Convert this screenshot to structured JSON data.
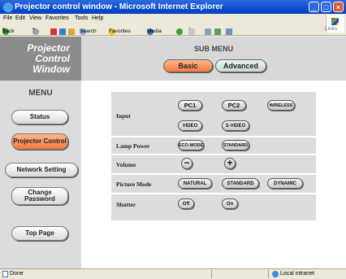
{
  "window": {
    "title": "Projector control window - Microsoft Internet Explorer"
  },
  "menubar": {
    "items": [
      "File",
      "Edit",
      "View",
      "Favorites",
      "Tools",
      "Help"
    ]
  },
  "toolbar": {
    "back": "Back",
    "search": "Search",
    "favorites": "Favorites",
    "media": "Media",
    "links": "Links"
  },
  "logo": {
    "line1": "Projector",
    "line2": "Control",
    "line3": "Window"
  },
  "sidebar": {
    "menu_title": "MENU",
    "items": [
      "Status",
      "Projector Control",
      "Network Setting",
      "Change Password",
      "Top Page"
    ],
    "active": "Projector Control"
  },
  "submenu": {
    "title": "SUB MENU",
    "basic": "Basic",
    "advanced": "Advanced",
    "active": "Basic"
  },
  "controls": {
    "input": {
      "label": "Input",
      "options": [
        "PC1",
        "PC2",
        "WIRELESS",
        "VIDEO",
        "S-VIDEO"
      ]
    },
    "lamp_power": {
      "label": "Lamp Power",
      "options": [
        "ECO-MODE",
        "STANDARD"
      ]
    },
    "volume": {
      "label": "Volume",
      "minus": "−",
      "plus": "+"
    },
    "picture_mode": {
      "label": "Picture Mode",
      "options": [
        "NATURAL",
        "STANDARD",
        "DYNAMIC"
      ]
    },
    "shutter": {
      "label": "Shutter",
      "options": [
        "Off",
        "On"
      ]
    }
  },
  "status": {
    "text": "Done",
    "zone": "Local intranet"
  },
  "colors": {
    "accent": "#f47a3e",
    "titlebar": "#0a4ed0",
    "sidebar": "#dcdcdc"
  },
  "icons": {
    "window": "ie-icon",
    "minimize": "minimize-icon",
    "maximize": "maximize-icon",
    "close": "close-icon"
  }
}
